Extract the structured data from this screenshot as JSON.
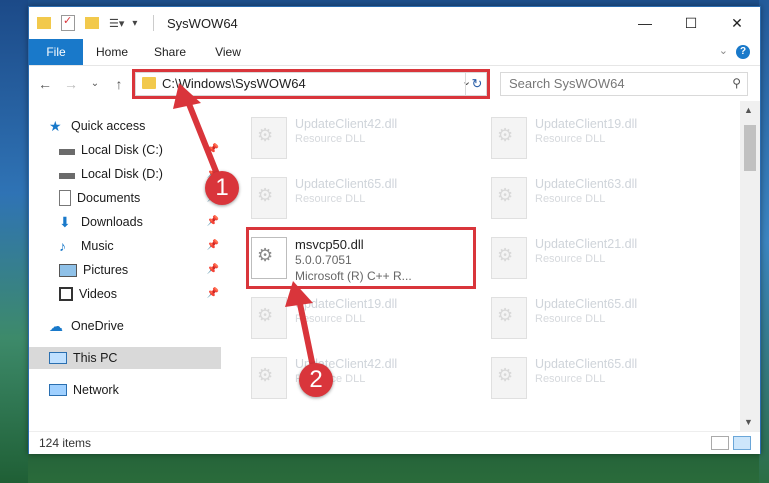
{
  "window": {
    "title": "SysWOW64",
    "min_glyph": "—",
    "max_glyph": "☐",
    "close_glyph": "✕"
  },
  "ribbon": {
    "tabs": [
      "File",
      "Home",
      "Share",
      "View"
    ],
    "expand_glyph": "⌄",
    "help_glyph": "?"
  },
  "nav": {
    "back_glyph": "←",
    "forward_glyph": "→",
    "recent_glyph": "⌄",
    "up_glyph": "↑",
    "address": "C:\\Windows\\SysWOW64",
    "address_dd_glyph": "⌄",
    "refresh_glyph": "↻",
    "search_placeholder": "Search SysWOW64",
    "search_glyph": "⚲"
  },
  "sidebar": {
    "items": [
      {
        "label": "Quick access",
        "icon": "star-icon",
        "pinned": false
      },
      {
        "label": "Local Disk (C:)",
        "icon": "drive-icon",
        "pinned": true
      },
      {
        "label": "Local Disk (D:)",
        "icon": "drive-icon",
        "pinned": true
      },
      {
        "label": "Documents",
        "icon": "documents-icon",
        "pinned": true
      },
      {
        "label": "Downloads",
        "icon": "downloads-icon",
        "pinned": true
      },
      {
        "label": "Music",
        "icon": "music-icon",
        "pinned": true
      },
      {
        "label": "Pictures",
        "icon": "pictures-icon",
        "pinned": true
      },
      {
        "label": "Videos",
        "icon": "videos-icon",
        "pinned": true
      },
      {
        "label": "OneDrive",
        "icon": "cloud-icon",
        "pinned": false
      },
      {
        "label": "This PC",
        "icon": "computer-icon",
        "pinned": false
      },
      {
        "label": "Network",
        "icon": "network-icon",
        "pinned": false
      }
    ],
    "pin_glyph": "📌"
  },
  "files": [
    {
      "name": "UpdateClient42.dll",
      "desc": "Resource DLL"
    },
    {
      "name": "UpdateClient19.dll",
      "desc": "Resource DLL"
    },
    {
      "name": "UpdateClient65.dll",
      "desc": "Resource DLL"
    },
    {
      "name": "UpdateClient63.dll",
      "desc": "Resource DLL"
    },
    {
      "name": "msvcp50.dll",
      "desc": "5.0.0.7051",
      "desc2": "Microsoft (R) C++ R..."
    },
    {
      "name": "UpdateClient21.dll",
      "desc": "Resource DLL"
    },
    {
      "name": "UpdateClient19.dll",
      "desc": "Resource DLL"
    },
    {
      "name": "UpdateClient65.dll",
      "desc": "Resource DLL"
    },
    {
      "name": "UpdateClient42.dll",
      "desc": "Resource DLL"
    },
    {
      "name": "UpdateClient65.dll",
      "desc": "Resource DLL"
    }
  ],
  "status": {
    "count": "124 items"
  },
  "annotations": {
    "step1": "1",
    "step2": "2",
    "color": "#d9353b"
  },
  "colors": {
    "accent": "#1979ca",
    "selection": "#cce8ff"
  }
}
